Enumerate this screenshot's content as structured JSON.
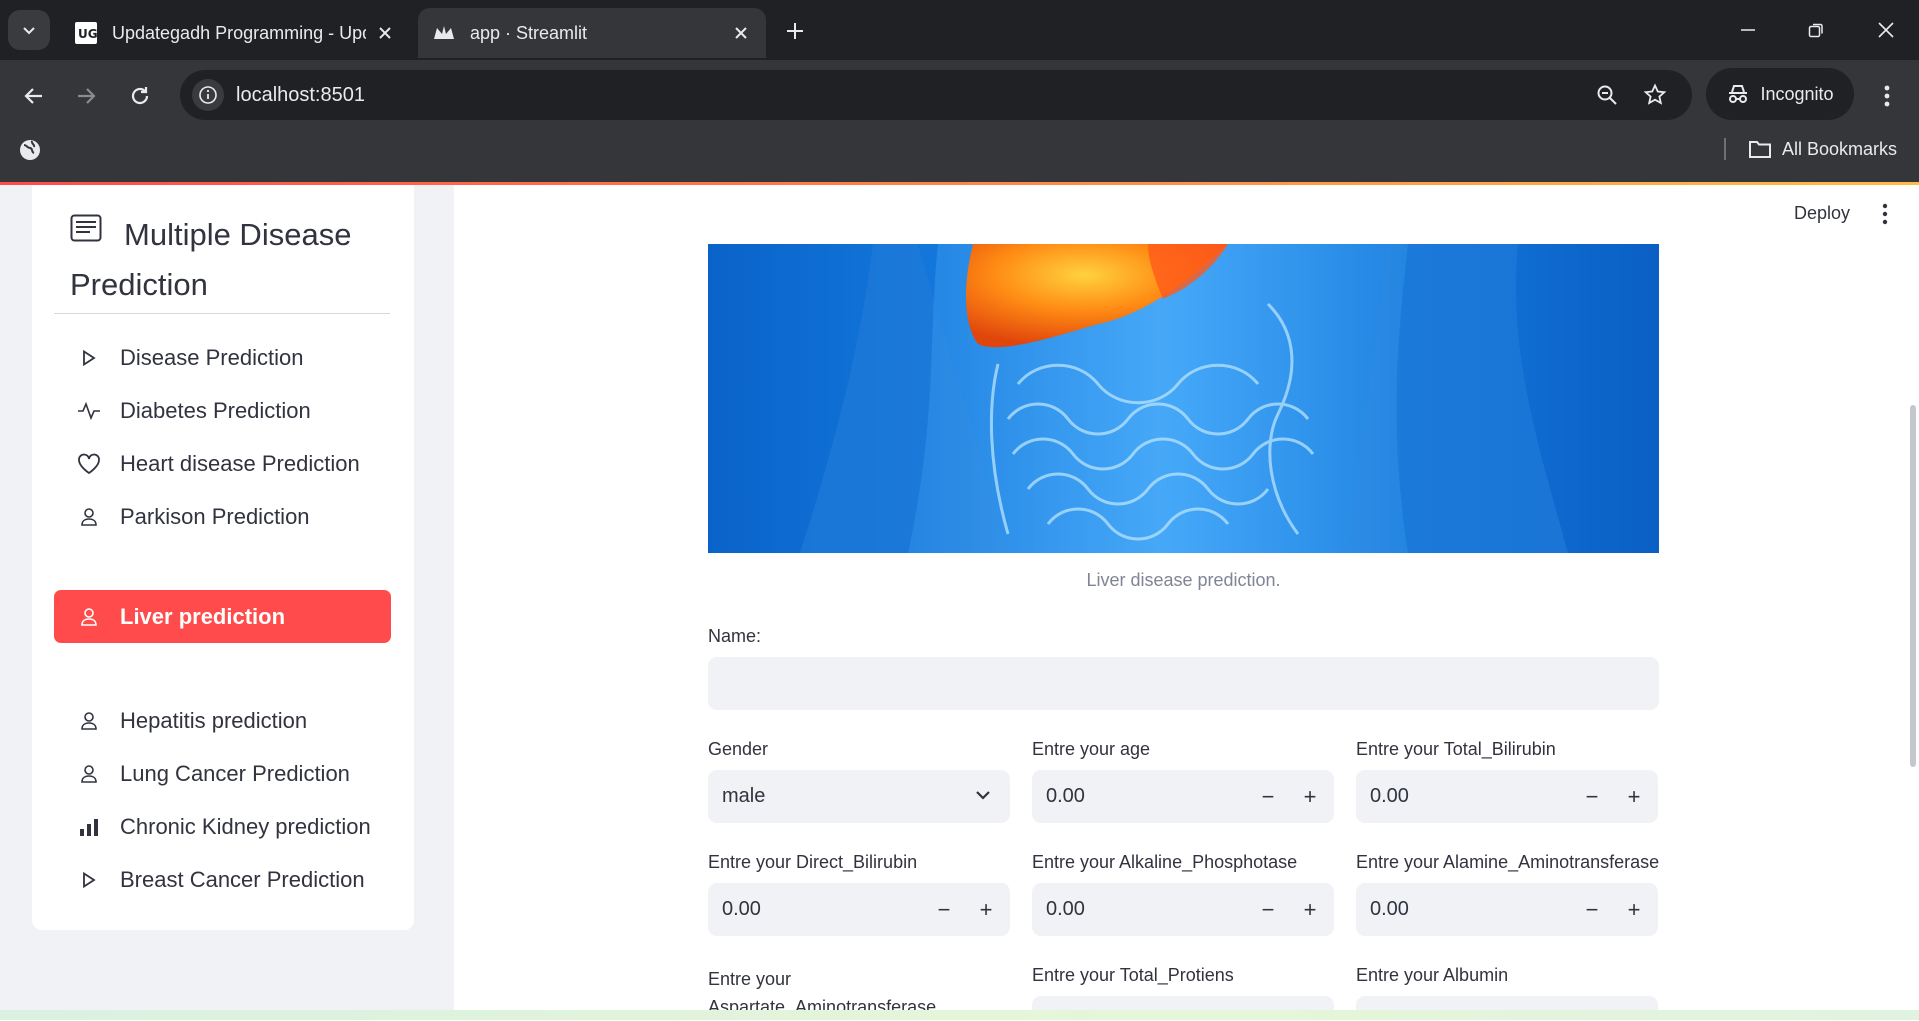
{
  "browser": {
    "tabs": [
      {
        "title": "Updategadh Programming - Updategadh",
        "favicon": "ug-logo-icon",
        "active": false
      },
      {
        "title": "app · Streamlit",
        "favicon": "streamlit-crown-icon",
        "active": true
      }
    ],
    "url": "localhost:8501",
    "profile_label": "Incognito",
    "bookmarks_label": "All Bookmarks"
  },
  "app": {
    "deploy_label": "Deploy",
    "sidebar": {
      "title": "Multiple Disease Prediction",
      "items": [
        {
          "label": "Disease Prediction",
          "icon": "play-icon",
          "active": false
        },
        {
          "label": "Diabetes Prediction",
          "icon": "activity-icon",
          "active": false
        },
        {
          "label": "Heart disease Prediction",
          "icon": "heart-icon",
          "active": false
        },
        {
          "label": "Parkison Prediction",
          "icon": "person-icon",
          "active": false
        },
        {
          "label": "Liver prediction",
          "icon": "person-icon",
          "active": true
        },
        {
          "label": "Hepatitis prediction",
          "icon": "person-icon",
          "active": false
        },
        {
          "label": "Lung Cancer Prediction",
          "icon": "person-icon",
          "active": false
        },
        {
          "label": "Chronic Kidney prediction",
          "icon": "bar-chart-icon",
          "active": false
        },
        {
          "label": "Breast Cancer Prediction",
          "icon": "play-icon",
          "active": false
        }
      ]
    },
    "main": {
      "image_caption": "Liver disease prediction.",
      "name_label": "Name:",
      "name_value": "",
      "gender": {
        "label": "Gender",
        "value": "male"
      },
      "fields": [
        {
          "label": "Entre your age",
          "value": "0.00"
        },
        {
          "label": "Entre your Total_Bilirubin",
          "value": "0.00"
        },
        {
          "label": "Entre your Direct_Bilirubin",
          "value": "0.00"
        },
        {
          "label": "Entre your Alkaline_Phosphotase",
          "value": "0.00"
        },
        {
          "label": "Entre your Alamine_Aminotransferase",
          "value": "0.00"
        },
        {
          "label": "Entre your Aspartate_Aminotransferase",
          "value": ""
        },
        {
          "label": "Entre your Total_Protiens",
          "value": ""
        },
        {
          "label": "Entre your Albumin",
          "value": ""
        }
      ],
      "stepper": {
        "minus": "−",
        "plus": "+"
      }
    }
  },
  "colors": {
    "accent": "#ff4b4b",
    "sidebar_bg": "#f0f2f6",
    "chrome_dark": "#202124",
    "chrome_mid": "#353639"
  }
}
